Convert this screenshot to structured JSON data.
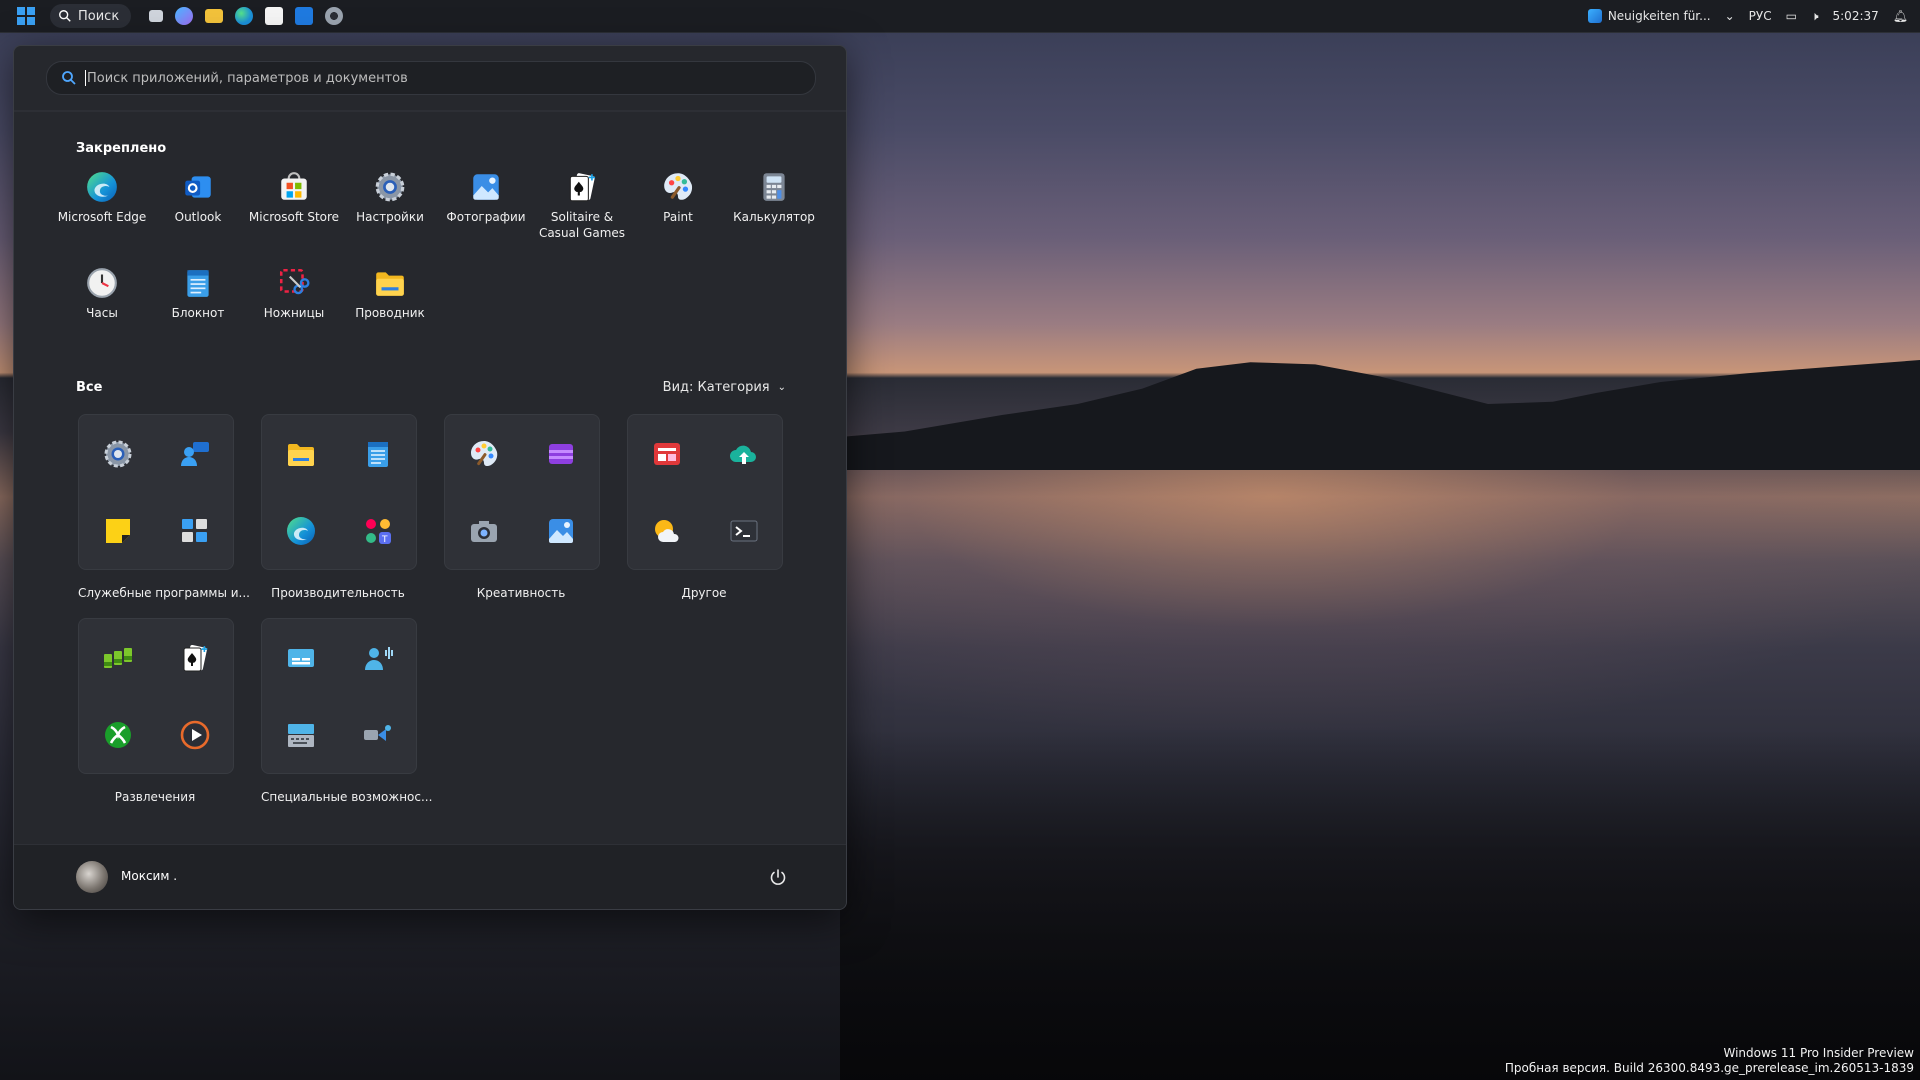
{
  "taskbar": {
    "search_label": "Поиск",
    "tray": {
      "news": "Neuigkeiten für...",
      "lang": "РУС",
      "time": "5:02:37"
    }
  },
  "start": {
    "search_placeholder": "Поиск приложений, параметров и документов",
    "pinned_title": "Закреплено",
    "pinned": [
      {
        "label": "Microsoft Edge",
        "icon": "edge-icon"
      },
      {
        "label": "Outlook",
        "icon": "outlook-icon"
      },
      {
        "label": "Microsoft Store",
        "icon": "store-icon"
      },
      {
        "label": "Настройки",
        "icon": "settings-icon"
      },
      {
        "label": "Фотографии",
        "icon": "photos-icon"
      },
      {
        "label": "Solitaire & Casual Games",
        "icon": "solitaire-icon"
      },
      {
        "label": "Paint",
        "icon": "paint-icon"
      },
      {
        "label": "Калькулятор",
        "icon": "calculator-icon"
      },
      {
        "label": "Часы",
        "icon": "clock-icon"
      },
      {
        "label": "Блокнот",
        "icon": "notepad-icon"
      },
      {
        "label": "Ножницы",
        "icon": "snipping-tool-icon"
      },
      {
        "label": "Проводник",
        "icon": "file-explorer-icon"
      }
    ],
    "all_title": "Все",
    "view_label": "Вид: Категория",
    "categories": [
      {
        "name": "Служебные программы и...",
        "icons": [
          "settings-icon",
          "quick-assist-icon",
          "sticky-notes-icon",
          "remote-desktop-icon"
        ]
      },
      {
        "name": "Производительность",
        "icons": [
          "file-explorer-icon",
          "notepad-icon",
          "edge-icon",
          "teams-icon"
        ]
      },
      {
        "name": "Креативность",
        "icons": [
          "paint-icon",
          "clipchamp-icon",
          "camera-icon",
          "photos-icon"
        ]
      },
      {
        "name": "Другое",
        "icons": [
          "news-icon",
          "cloud-upload-icon",
          "weather-icon",
          "terminal-icon"
        ]
      },
      {
        "name": "Развлечения",
        "icons": [
          "solitaire-bar-icon",
          "solitaire-icon",
          "xbox-icon",
          "media-player-icon"
        ]
      },
      {
        "name": "Специальные возможнос...",
        "icons": [
          "live-captions-icon",
          "voice-access-icon",
          "on-screen-keyboard-icon",
          "narrator-icon"
        ]
      }
    ],
    "user": "Моксим ."
  },
  "watermark": {
    "line1": "Windows 11 Pro Insider Preview",
    "line2": "Пробная версия. Build 26300.8493.ge_prerelease_im.260513-1839"
  }
}
